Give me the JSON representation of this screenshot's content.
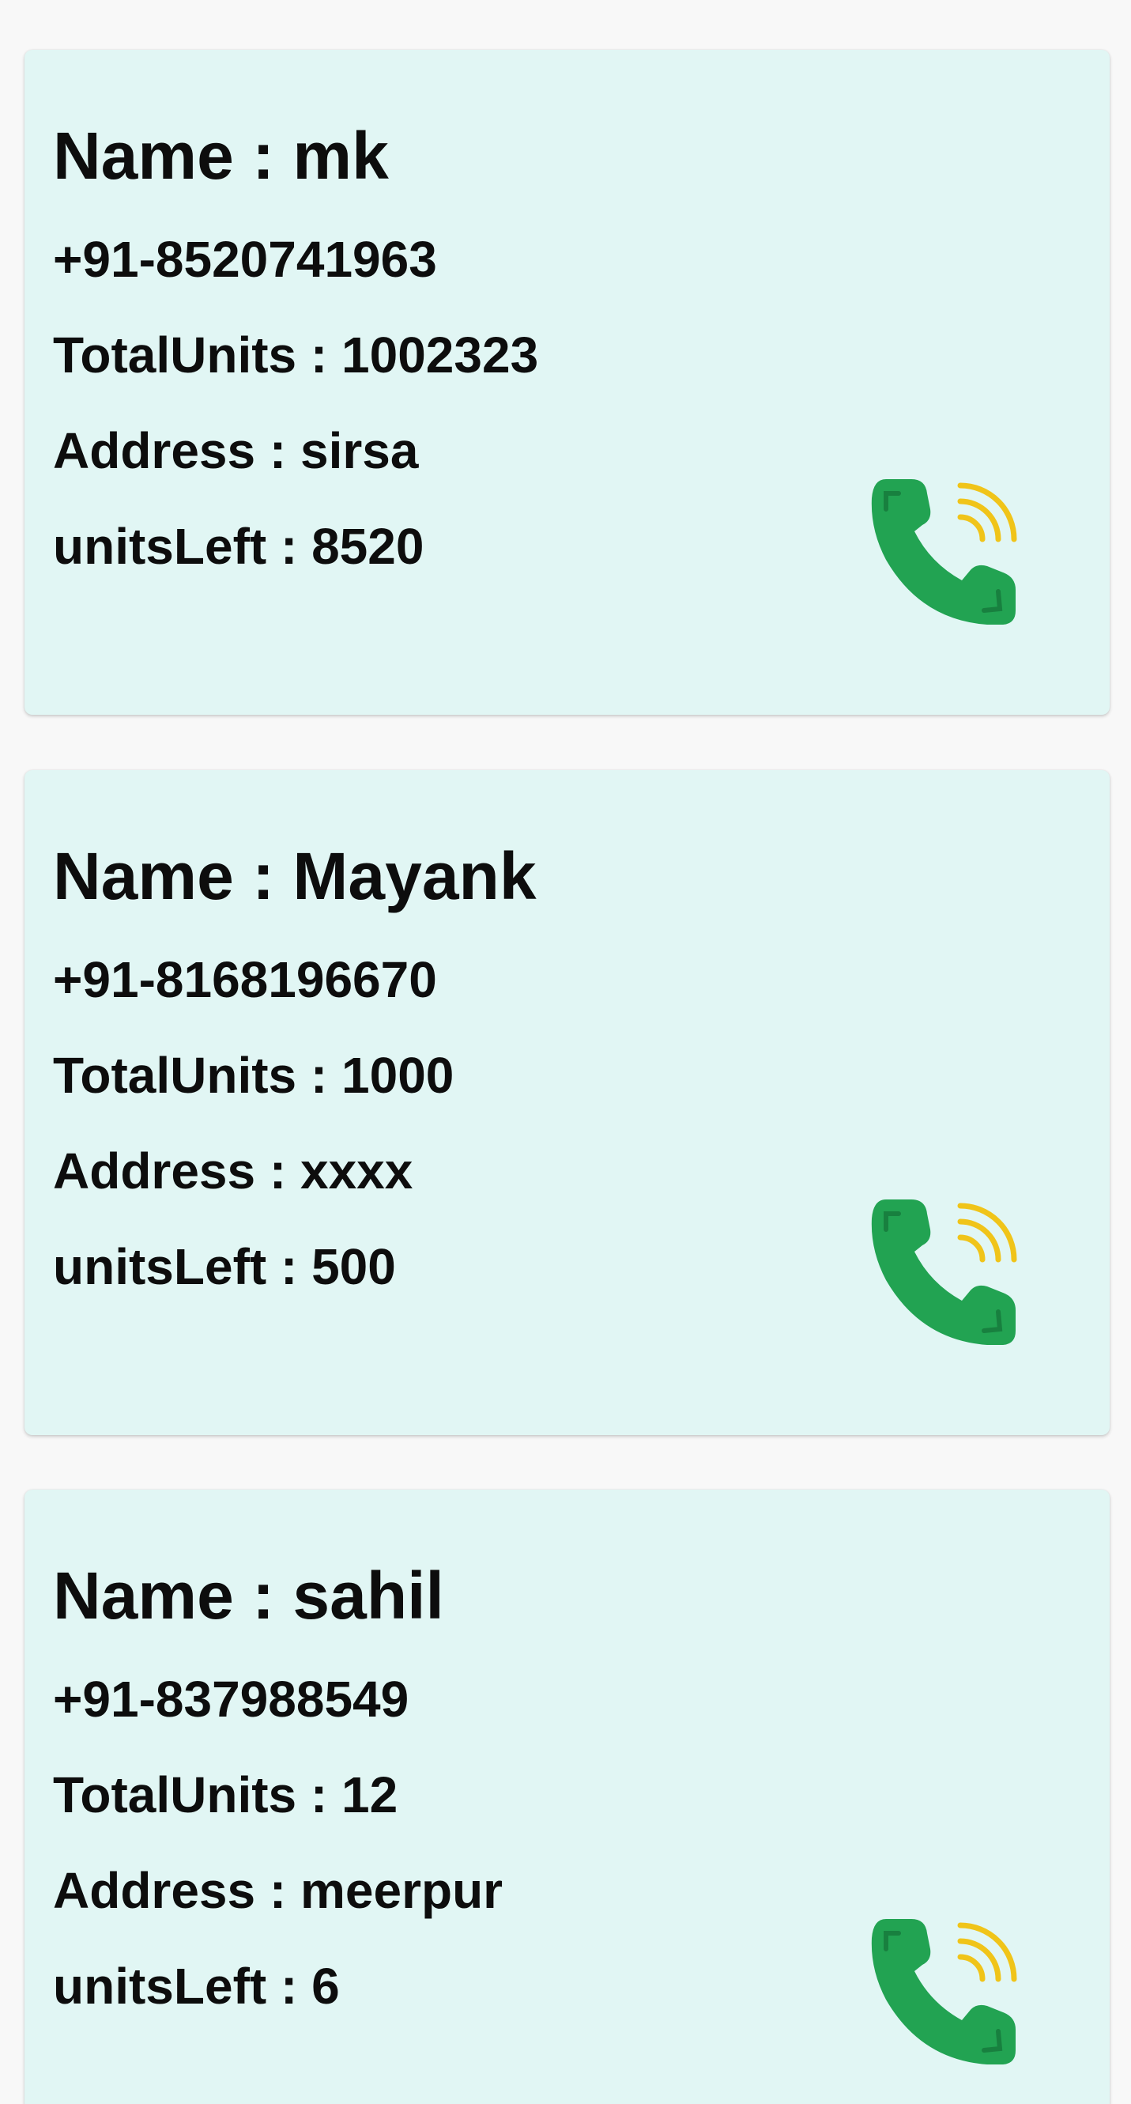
{
  "customers": [
    {
      "name": "Name : mk",
      "phone": "+91-8520741963",
      "total_units": "TotalUnits : 1002323",
      "address": "Address : sirsa",
      "units_left": "unitsLeft : 8520",
      "call_icon": "phone-call-icon"
    },
    {
      "name": "Name : Mayank",
      "phone": "+91-8168196670",
      "total_units": "TotalUnits : 1000",
      "address": "Address : xxxx",
      "units_left": "unitsLeft : 500",
      "call_icon": "phone-call-icon"
    },
    {
      "name": "Name : sahil",
      "phone": "+91-837988549",
      "total_units": "TotalUnits : 12",
      "address": "Address : meerpur",
      "units_left": "unitsLeft : 6",
      "call_icon": "phone-call-icon"
    }
  ],
  "colors": {
    "page_background": "#f8f8f8",
    "card_background": "#e1f6f4",
    "phone_green": "#22a352",
    "phone_green_dark": "#18803f",
    "signal_yellow": "#f0c419"
  }
}
